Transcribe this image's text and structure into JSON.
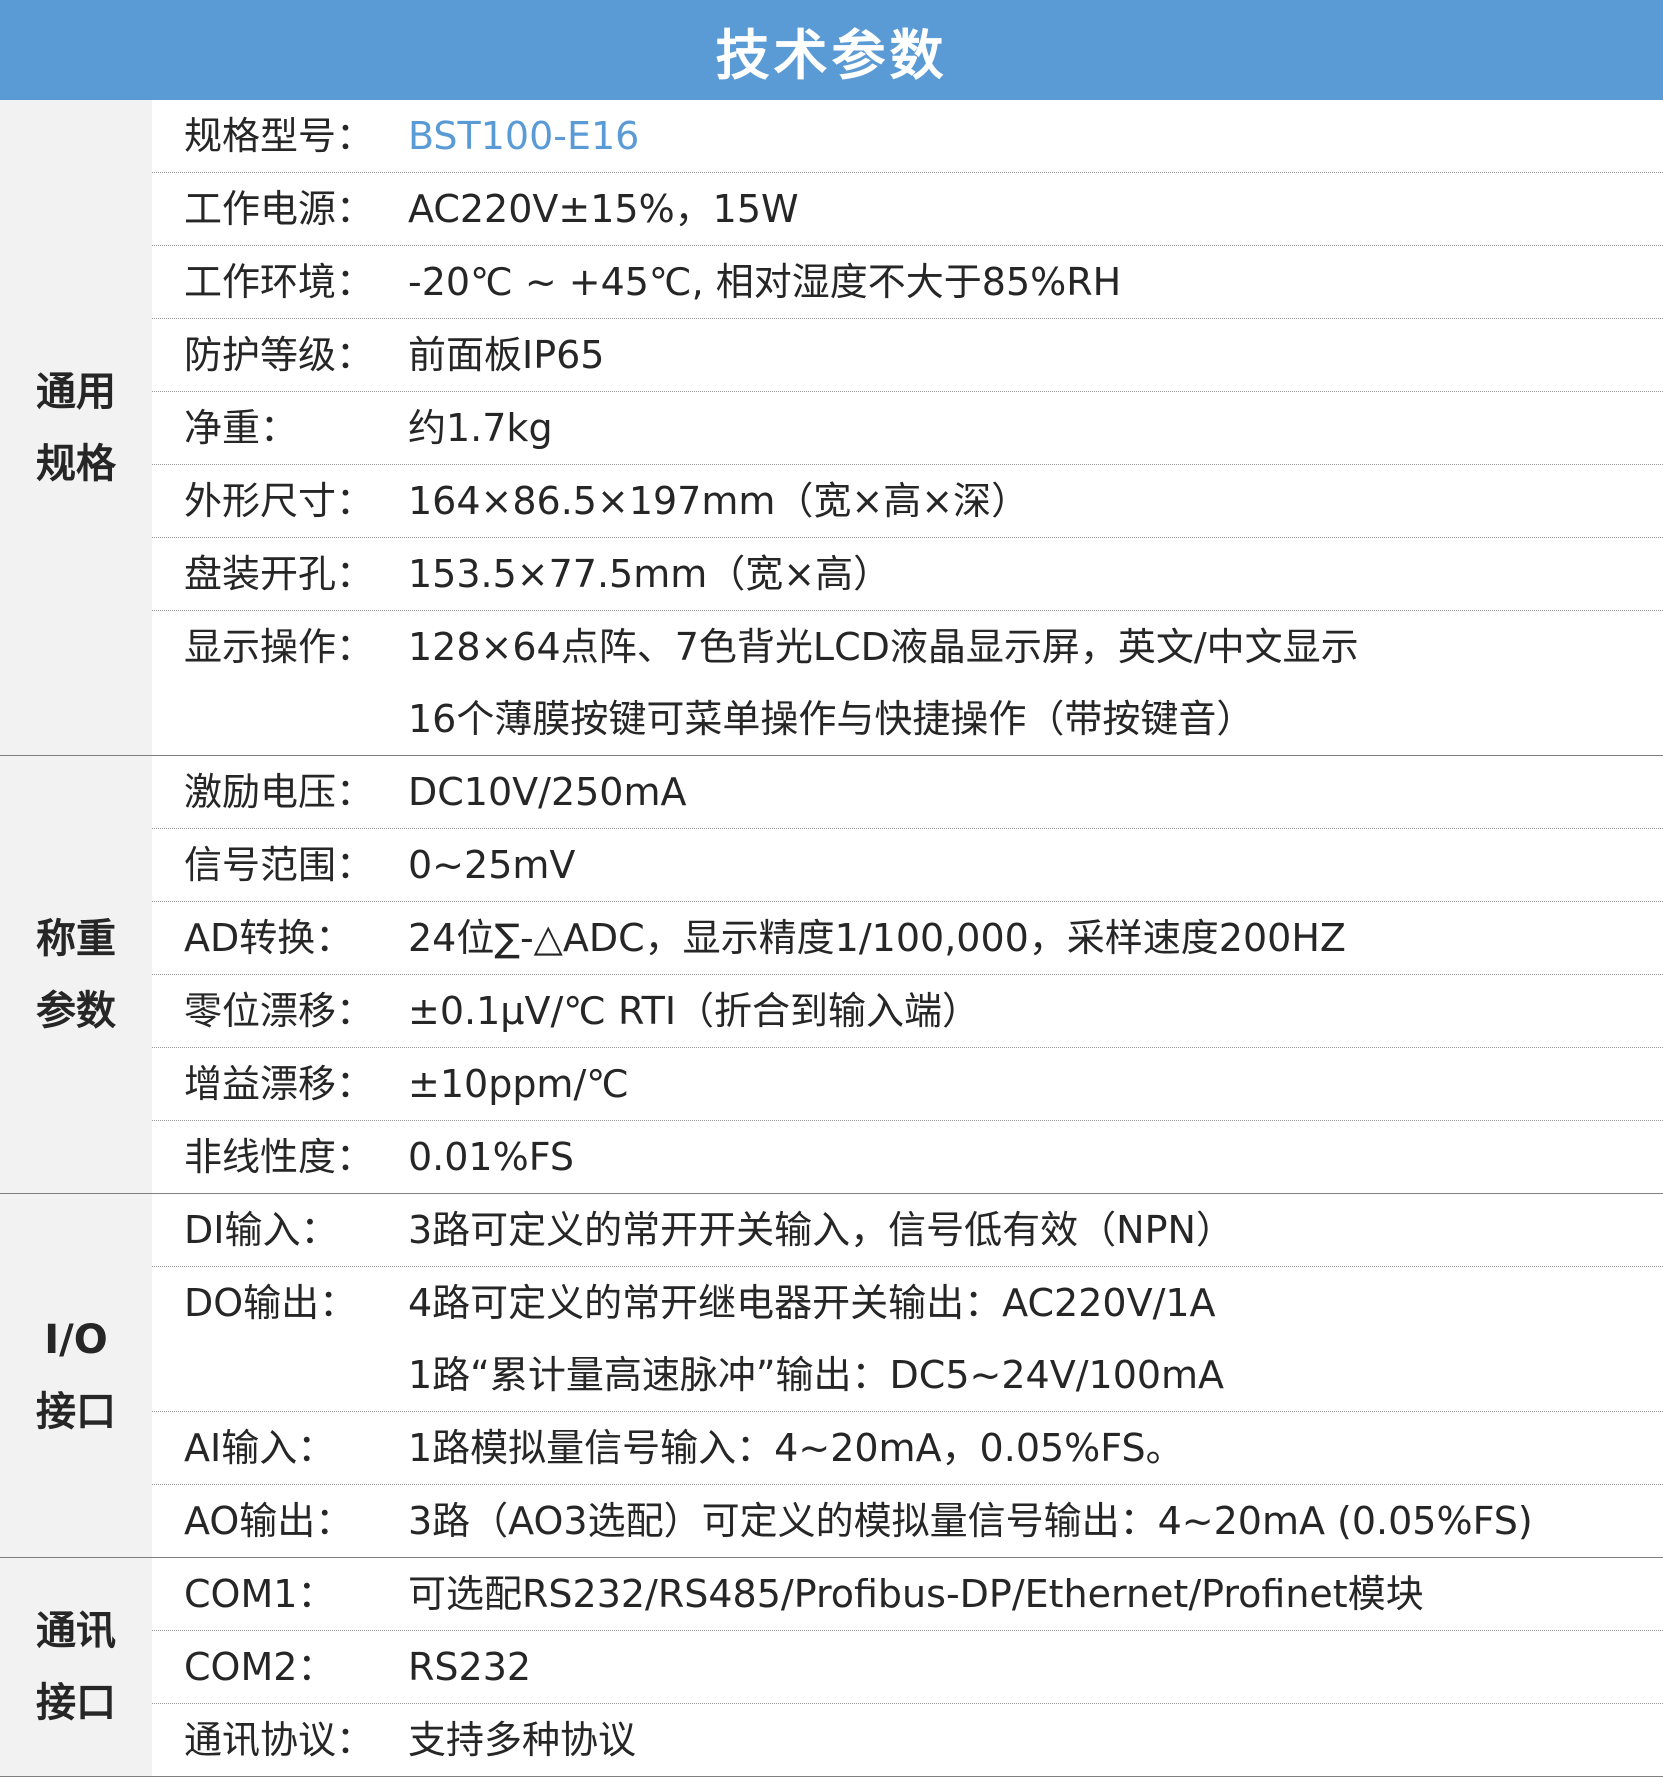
{
  "title": "技术参数",
  "accent_color": "#5b9bd5",
  "label_bg_color": "#f2f2f2",
  "sections": [
    {
      "label_lines": [
        "通用",
        "规格"
      ],
      "rows": [
        {
          "key": "规格型号：",
          "values": [
            "BST100-E16"
          ],
          "accent": true
        },
        {
          "key": "工作电源：",
          "values": [
            "AC220V±15%，15W"
          ]
        },
        {
          "key": "工作环境：",
          "values": [
            "-20℃ ~ +45℃, 相对湿度不大于85%RH"
          ]
        },
        {
          "key": "防护等级：",
          "values": [
            "前面板IP65"
          ]
        },
        {
          "key": "净重：",
          "values": [
            "约1.7kg"
          ]
        },
        {
          "key": "外形尺寸：",
          "values": [
            "164×86.5×197mm（宽×高×深）"
          ]
        },
        {
          "key": "盘装开孔：",
          "values": [
            "153.5×77.5mm（宽×高）"
          ]
        },
        {
          "key": "显示操作：",
          "values": [
            "128×64点阵、7色背光LCD液晶显示屏，英文/中文显示",
            "16个薄膜按键可菜单操作与快捷操作（带按键音）"
          ]
        }
      ]
    },
    {
      "label_lines": [
        "称重",
        "参数"
      ],
      "rows": [
        {
          "key": "激励电压：",
          "values": [
            "DC10V/250mA"
          ]
        },
        {
          "key": "信号范围：",
          "values": [
            "0~25mV"
          ]
        },
        {
          "key": "AD转换：",
          "values": [
            "24位∑-△ADC，显示精度1/100,000，采样速度200HZ"
          ]
        },
        {
          "key": "零位漂移：",
          "values": [
            "±0.1μV/℃ RTI（折合到输入端）"
          ]
        },
        {
          "key": "增益漂移：",
          "values": [
            "±10ppm/℃"
          ]
        },
        {
          "key": "非线性度：",
          "values": [
            "0.01%FS"
          ]
        }
      ]
    },
    {
      "label_lines": [
        "I/O",
        "接口"
      ],
      "rows": [
        {
          "key": "DI输入：",
          "values": [
            "3路可定义的常开开关输入，信号低有效（NPN）"
          ]
        },
        {
          "key": "DO输出：",
          "values": [
            "4路可定义的常开继电器开关输出：AC220V/1A",
            "1路“累计量高速脉冲”输出：DC5~24V/100mA"
          ]
        },
        {
          "key": "AI输入：",
          "values": [
            "1路模拟量信号输入：4~20mA，0.05%FS。"
          ]
        },
        {
          "key": "AO输出：",
          "values": [
            "3路（AO3选配）可定义的模拟量信号输出：4~20mA (0.05%FS)"
          ]
        }
      ]
    },
    {
      "label_lines": [
        "通讯",
        "接口"
      ],
      "rows": [
        {
          "key": "COM1：",
          "values": [
            "可选配RS232/RS485/Profibus-DP/Ethernet/Profinet模块"
          ]
        },
        {
          "key": "COM2：",
          "values": [
            "RS232"
          ]
        },
        {
          "key": "通讯协议：",
          "values": [
            "支持多种协议"
          ]
        }
      ]
    }
  ]
}
